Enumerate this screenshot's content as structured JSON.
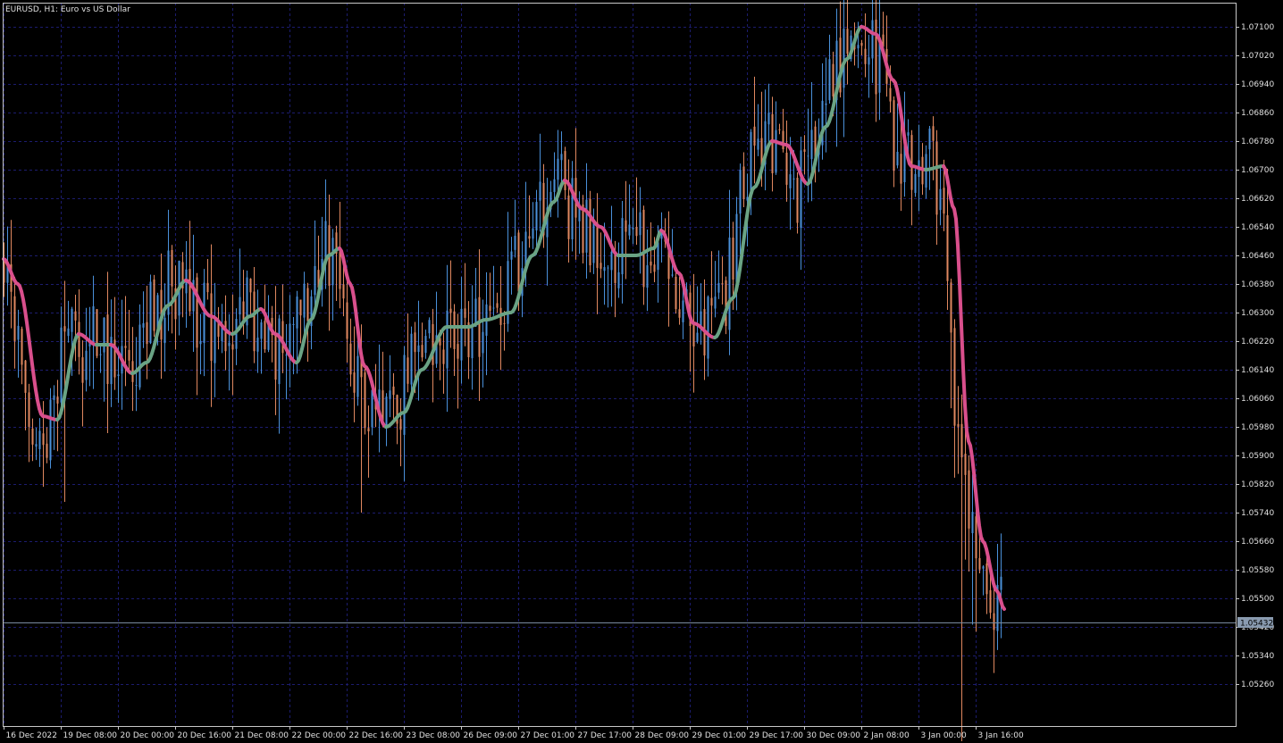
{
  "window": {
    "title": "EURUSD, H1:  Euro vs US Dollar"
  },
  "colors": {
    "background": "#000000",
    "grid": "#1c1c6e",
    "axis": "#c8c8c8",
    "candle_up": "#4a90d9",
    "candle_down": "#e08860",
    "ma_falling": "#d94f8c",
    "ma_rising": "#6aa384",
    "price_line": "#7a8aa0",
    "price_tag_bg": "#8a9bb0"
  },
  "current_price": {
    "label": "1.05432",
    "value": 1.05432
  },
  "chart_data": {
    "type": "candlestick",
    "symbol": "EURUSD",
    "timeframe": "H1",
    "description": "Euro vs US Dollar",
    "ylim": [
      1.0522,
      1.0714
    ],
    "y_ticks": [
      "1.07100",
      "1.07020",
      "1.06940",
      "1.06860",
      "1.06780",
      "1.06700",
      "1.06620",
      "1.06540",
      "1.06460",
      "1.06380",
      "1.06300",
      "1.06220",
      "1.06140",
      "1.06060",
      "1.05980",
      "1.05900",
      "1.05820",
      "1.05740",
      "1.05660",
      "1.05580",
      "1.05500",
      "1.05420",
      "1.05340",
      "1.05260"
    ],
    "y_tick_values": [
      1.071,
      1.0702,
      1.0694,
      1.0686,
      1.0678,
      1.067,
      1.0662,
      1.0654,
      1.0646,
      1.0638,
      1.063,
      1.0622,
      1.0614,
      1.0606,
      1.0598,
      1.059,
      1.0582,
      1.0574,
      1.0566,
      1.0558,
      1.055,
      1.0542,
      1.0534,
      1.0526
    ],
    "x_ticks": [
      {
        "label": "16 Dec 2022",
        "bar": 0
      },
      {
        "label": "19 Dec 08:00",
        "bar": 16
      },
      {
        "label": "20 Dec 00:00",
        "bar": 32
      },
      {
        "label": "20 Dec 16:00",
        "bar": 48
      },
      {
        "label": "21 Dec 08:00",
        "bar": 64
      },
      {
        "label": "22 Dec 00:00",
        "bar": 80
      },
      {
        "label": "22 Dec 16:00",
        "bar": 96
      },
      {
        "label": "23 Dec 08:00",
        "bar": 112
      },
      {
        "label": "26 Dec 09:00",
        "bar": 128
      },
      {
        "label": "27 Dec 01:00",
        "bar": 144
      },
      {
        "label": "27 Dec 17:00",
        "bar": 160
      },
      {
        "label": "28 Dec 09:00",
        "bar": 176
      },
      {
        "label": "29 Dec 01:00",
        "bar": 192
      },
      {
        "label": "29 Dec 17:00",
        "bar": 208
      },
      {
        "label": "30 Dec 09:00",
        "bar": 224
      },
      {
        "label": "2 Jan 08:00",
        "bar": 240
      },
      {
        "label": "3 Jan 00:00",
        "bar": 256
      },
      {
        "label": "3 Jan 16:00",
        "bar": 272
      }
    ],
    "bar_count": 280,
    "ma_anchors": [
      {
        "bar": 0,
        "value": 1.0645
      },
      {
        "bar": 4,
        "value": 1.0638
      },
      {
        "bar": 11,
        "value": 1.0601
      },
      {
        "bar": 15,
        "value": 1.06
      },
      {
        "bar": 21,
        "value": 1.0624
      },
      {
        "bar": 26,
        "value": 1.0621
      },
      {
        "bar": 30,
        "value": 1.0621
      },
      {
        "bar": 36,
        "value": 1.0613
      },
      {
        "bar": 40,
        "value": 1.0616
      },
      {
        "bar": 46,
        "value": 1.0632
      },
      {
        "bar": 51,
        "value": 1.0639
      },
      {
        "bar": 58,
        "value": 1.0629
      },
      {
        "bar": 64,
        "value": 1.0624
      },
      {
        "bar": 69,
        "value": 1.0629
      },
      {
        "bar": 72,
        "value": 1.0631
      },
      {
        "bar": 76,
        "value": 1.0624
      },
      {
        "bar": 82,
        "value": 1.0616
      },
      {
        "bar": 86,
        "value": 1.0628
      },
      {
        "bar": 91,
        "value": 1.0646
      },
      {
        "bar": 94,
        "value": 1.0648
      },
      {
        "bar": 97,
        "value": 1.0638
      },
      {
        "bar": 101,
        "value": 1.0615
      },
      {
        "bar": 107,
        "value": 1.0598
      },
      {
        "bar": 112,
        "value": 1.0602
      },
      {
        "bar": 117,
        "value": 1.0614
      },
      {
        "bar": 124,
        "value": 1.0626
      },
      {
        "bar": 130,
        "value": 1.0626
      },
      {
        "bar": 135,
        "value": 1.0628
      },
      {
        "bar": 142,
        "value": 1.063
      },
      {
        "bar": 148,
        "value": 1.0646
      },
      {
        "bar": 154,
        "value": 1.0661
      },
      {
        "bar": 157,
        "value": 1.0667
      },
      {
        "bar": 162,
        "value": 1.0659
      },
      {
        "bar": 167,
        "value": 1.0654
      },
      {
        "bar": 172,
        "value": 1.0646
      },
      {
        "bar": 177,
        "value": 1.0646
      },
      {
        "bar": 182,
        "value": 1.0648
      },
      {
        "bar": 184,
        "value": 1.0653
      },
      {
        "bar": 189,
        "value": 1.0641
      },
      {
        "bar": 193,
        "value": 1.0627
      },
      {
        "bar": 199,
        "value": 1.0623
      },
      {
        "bar": 204,
        "value": 1.0634
      },
      {
        "bar": 210,
        "value": 1.0665
      },
      {
        "bar": 215,
        "value": 1.0678
      },
      {
        "bar": 219,
        "value": 1.0677
      },
      {
        "bar": 225,
        "value": 1.0666
      },
      {
        "bar": 230,
        "value": 1.0682
      },
      {
        "bar": 236,
        "value": 1.0701
      },
      {
        "bar": 240,
        "value": 1.071
      },
      {
        "bar": 244,
        "value": 1.0708
      },
      {
        "bar": 249,
        "value": 1.0695
      },
      {
        "bar": 254,
        "value": 1.0671
      },
      {
        "bar": 258,
        "value": 1.067
      },
      {
        "bar": 263,
        "value": 1.0671
      },
      {
        "bar": 266,
        "value": 1.0659
      },
      {
        "bar": 270,
        "value": 1.0594
      },
      {
        "bar": 274,
        "value": 1.0566
      },
      {
        "bar": 278,
        "value": 1.0552
      },
      {
        "bar": 280,
        "value": 1.0547
      }
    ],
    "extremes": [
      {
        "bar": 17,
        "value": 1.0577
      },
      {
        "bar": 100,
        "value": 1.0574
      },
      {
        "bar": 234,
        "value": 1.0712
      },
      {
        "bar": 268,
        "value": 1.0522
      }
    ]
  }
}
